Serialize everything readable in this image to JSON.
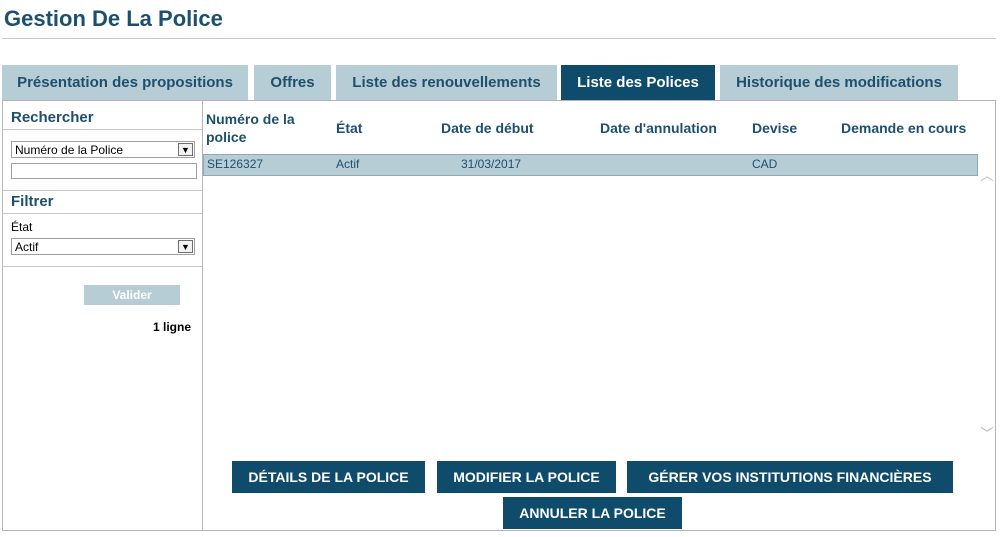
{
  "header": {
    "title": "Gestion De La Police"
  },
  "tabs": [
    {
      "label": "Présentation des propositions",
      "active": false
    },
    {
      "label": "Offres",
      "active": false
    },
    {
      "label": "Liste des renouvellements",
      "active": false
    },
    {
      "label": "Liste des Polices",
      "active": true
    },
    {
      "label": "Historique des modifications",
      "active": false
    }
  ],
  "sidebar": {
    "search": {
      "heading": "Rechercher",
      "select_value": "Numéro de la Police",
      "input_value": ""
    },
    "filter": {
      "heading": "Filtrer",
      "state_label": "État",
      "state_value": "Actif"
    },
    "validate_label": "Valider",
    "result_count": "1 ligne"
  },
  "table": {
    "columns": [
      "Numéro de la police",
      "État",
      "Date de début",
      "Date d'annulation",
      "Devise",
      "Demande en cours"
    ],
    "rows": [
      [
        "SE126327",
        "Actif",
        "31/03/2017",
        "",
        "CAD",
        ""
      ]
    ]
  },
  "actions": {
    "details": "DÉTAILS DE LA POLICE",
    "modify": "MODIFIER LA POLICE",
    "manage_institutions": "GÉRER VOS INSTITUTIONS FINANCIÈRES",
    "cancel": "ANNULER LA POLICE"
  },
  "colors": {
    "accent": "#0f4c6c",
    "tab_inactive": "#b7cdd5",
    "heading_text": "#1d4f6e"
  },
  "icons": {
    "select_arrow": "chevron-down-icon",
    "scroll_up": "chevron-up-icon",
    "scroll_down": "chevron-down-icon"
  }
}
